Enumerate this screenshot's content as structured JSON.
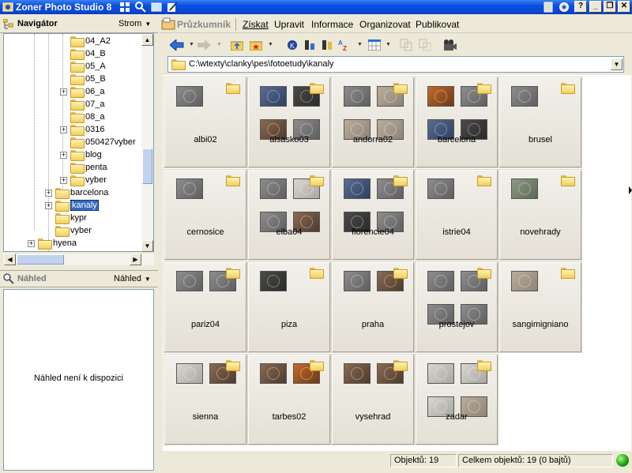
{
  "app": {
    "title": "Zoner Photo Studio 8"
  },
  "navigator": {
    "title": "Navigátor",
    "mode": "Strom"
  },
  "tree": {
    "items": [
      {
        "label": "04_A2",
        "depth": 3,
        "expander": false
      },
      {
        "label": "04_B",
        "depth": 3,
        "expander": false
      },
      {
        "label": "05_A",
        "depth": 3,
        "expander": false
      },
      {
        "label": "05_B",
        "depth": 3,
        "expander": false
      },
      {
        "label": "06_a",
        "depth": 3,
        "expander": true
      },
      {
        "label": "07_a",
        "depth": 3,
        "expander": false
      },
      {
        "label": "08_a",
        "depth": 3,
        "expander": false
      },
      {
        "label": "0316",
        "depth": 3,
        "expander": true
      },
      {
        "label": "050427vyber",
        "depth": 3,
        "expander": false
      },
      {
        "label": "blog",
        "depth": 3,
        "expander": true
      },
      {
        "label": "penta",
        "depth": 3,
        "expander": false
      },
      {
        "label": "vyber",
        "depth": 3,
        "expander": true
      },
      {
        "label": "barcelona",
        "depth": 2,
        "expander": true
      },
      {
        "label": "kanaly",
        "depth": 2,
        "expander": true,
        "selected": true
      },
      {
        "label": "kypr",
        "depth": 2,
        "expander": false
      },
      {
        "label": "vyber",
        "depth": 2,
        "expander": false
      },
      {
        "label": "hyena",
        "depth": 1,
        "expander": true
      }
    ]
  },
  "preview": {
    "title": "Náhled",
    "mode": "Náhled",
    "empty_text": "Náhled není k dispozici"
  },
  "menu": {
    "explorer": "Průzkumník",
    "items": [
      "Získat",
      "Upravit",
      "Informace",
      "Organizovat",
      "Publikovat"
    ]
  },
  "path": {
    "value": "C:\\wtexty\\clanky\\pes\\fotoetudy\\kanaly"
  },
  "folders": [
    {
      "name": "albi02",
      "previews": [
        "gray"
      ]
    },
    {
      "name": "alsasko03",
      "previews": [
        "blue",
        "dark",
        "rust",
        "gray"
      ]
    },
    {
      "name": "andorra02",
      "previews": [
        "gray",
        "tan",
        "tan",
        "tan"
      ]
    },
    {
      "name": "barcelona",
      "previews": [
        "orange",
        "gray",
        "blue",
        "dark"
      ]
    },
    {
      "name": "brusel",
      "previews": [
        "gray"
      ]
    },
    {
      "name": "cernosice",
      "previews": [
        "gray"
      ]
    },
    {
      "name": "elba04",
      "previews": [
        "gray",
        "light",
        "gray",
        "rust"
      ]
    },
    {
      "name": "florencie04",
      "previews": [
        "blue",
        "gray",
        "dark",
        "gray"
      ]
    },
    {
      "name": "istrie04",
      "previews": [
        "gray"
      ]
    },
    {
      "name": "novehrady",
      "previews": [
        "green"
      ]
    },
    {
      "name": "pariz04",
      "previews": [
        "gray",
        "gray"
      ]
    },
    {
      "name": "piza",
      "previews": [
        "dark"
      ]
    },
    {
      "name": "praha",
      "previews": [
        "gray",
        "rust"
      ]
    },
    {
      "name": "prostejov",
      "previews": [
        "gray",
        "gray",
        "gray",
        "gray"
      ]
    },
    {
      "name": "sangimigniano",
      "previews": [
        "tan"
      ]
    },
    {
      "name": "sienna",
      "previews": [
        "light",
        "rust"
      ]
    },
    {
      "name": "tarbes02",
      "previews": [
        "rust",
        "orange"
      ]
    },
    {
      "name": "vysehrad",
      "previews": [
        "rust",
        "rust"
      ]
    },
    {
      "name": "zadar",
      "previews": [
        "light",
        "light",
        "light",
        "tan"
      ]
    }
  ],
  "status": {
    "objects": "Objektů: 19",
    "total": "Celkem objektů: 19 (0 bajtů)"
  },
  "colors": {
    "titlebar": "#0a4ee0",
    "selection": "#316ac5",
    "status_ok": "#1a9a10"
  }
}
